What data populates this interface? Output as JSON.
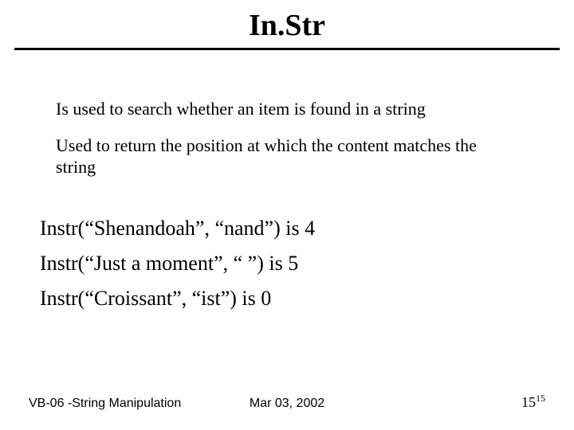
{
  "title": "In.Str",
  "descriptions": [
    "Is used to search whether an item is found in a string",
    "Used to return the position at which the content matches the string"
  ],
  "examples": [
    "Instr(“Shenandoah”, “nand”) is 4",
    "Instr(“Just a moment”, “ ”) is 5",
    "Instr(“Croissant”, “ist”) is 0"
  ],
  "footer": {
    "left": "VB-06 -String Manipulation",
    "center": "Mar 03, 2002",
    "page_main": "15",
    "page_sup": "15"
  }
}
